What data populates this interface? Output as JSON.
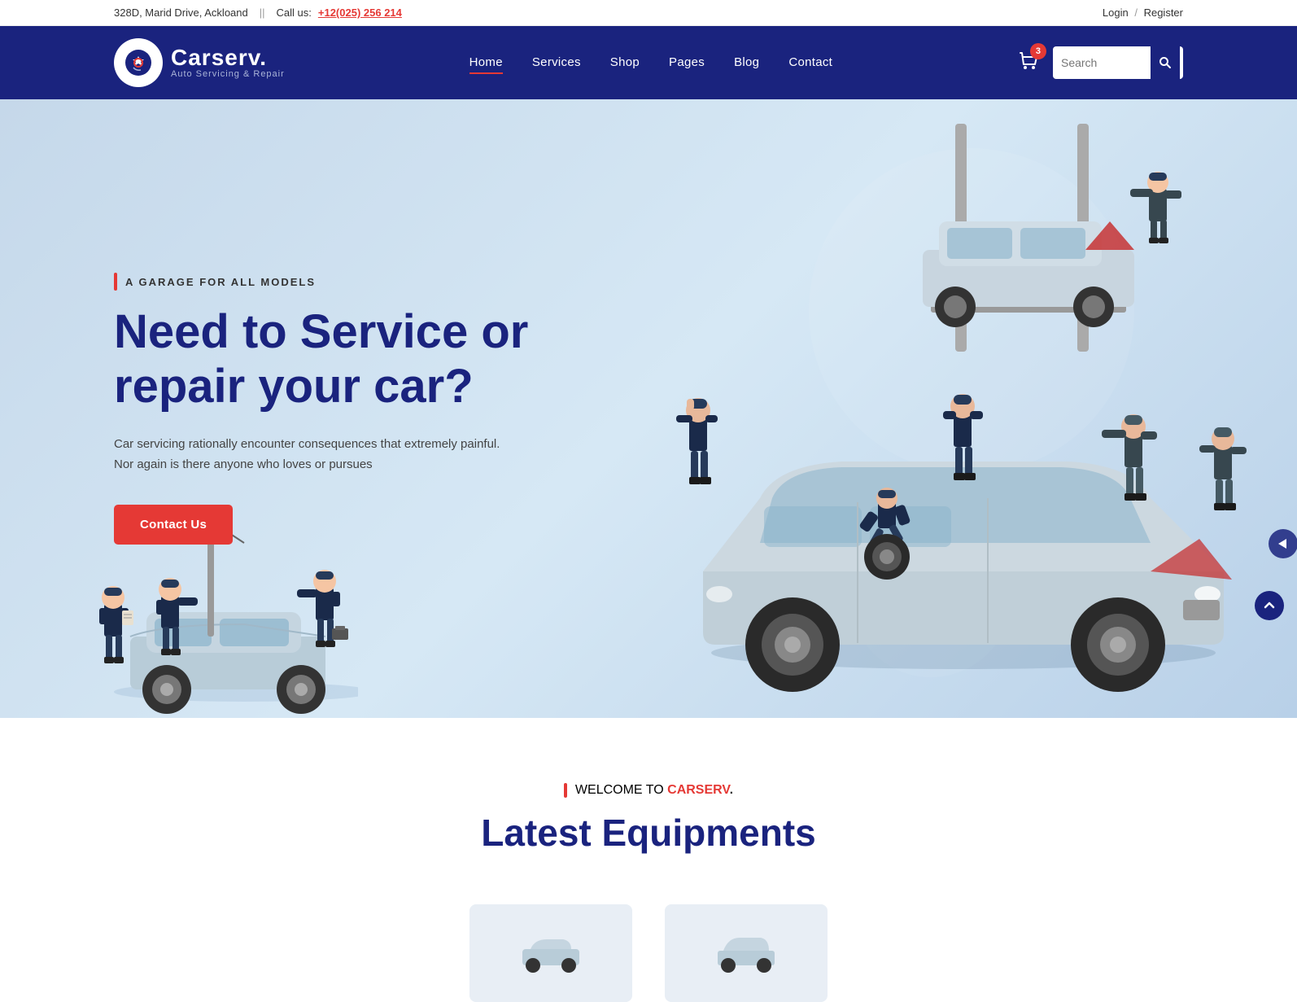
{
  "topbar": {
    "address": "328D, Marid Drive, Ackloand",
    "divider": "||",
    "callLabel": "Call us:",
    "phone": "+12(025) 256 214",
    "loginLabel": "Login",
    "separator": "/",
    "registerLabel": "Register"
  },
  "navbar": {
    "logoIconEmoji": "⚙️",
    "logoName": "Carserv.",
    "logoTagline": "Auto Servicing & Repair",
    "navItems": [
      {
        "label": "Home",
        "active": true
      },
      {
        "label": "Services",
        "active": false
      },
      {
        "label": "Shop",
        "active": false
      },
      {
        "label": "Pages",
        "active": false
      },
      {
        "label": "Blog",
        "active": false
      },
      {
        "label": "Contact",
        "active": false
      }
    ],
    "cartCount": "3",
    "searchPlaceholder": "Search"
  },
  "hero": {
    "tag": "A GARAGE FOR ALL MODELS",
    "title_line1": "Need to Service or",
    "title_line2": "repair your car?",
    "description": "Car servicing rationally encounter consequences that extremely painful. Nor again is there anyone who loves or pursues",
    "ctaLabel": "Contact Us"
  },
  "welcome": {
    "tag": "WELCOME TO",
    "brand": "CARSERV",
    "brandSuffix": ".",
    "title_line1": "Latest Equipments"
  },
  "colors": {
    "navBg": "#1a237e",
    "accent": "#e53935",
    "heroBg": "#ccdbe9",
    "text": "#333333"
  }
}
